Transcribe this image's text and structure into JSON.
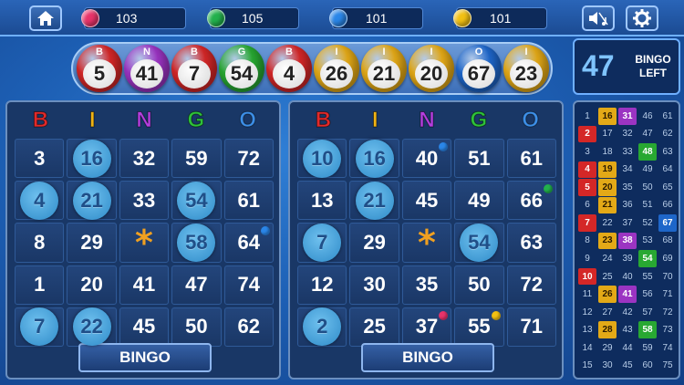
{
  "top_bar": {
    "home_icon": "home-icon",
    "gems": [
      {
        "name": "pink-gem-icon",
        "color": "#e8336a",
        "value": "103"
      },
      {
        "name": "green-gem-icon",
        "color": "#22b14c",
        "value": "105"
      },
      {
        "name": "blue-gem-icon",
        "color": "#2a86e8",
        "value": "101"
      },
      {
        "name": "yellow-gem-icon",
        "color": "#f2c012",
        "value": "101"
      }
    ],
    "sound_icon": "sound-music-icon",
    "settings_icon": "gear-icon"
  },
  "called_balls": [
    {
      "letter": "B",
      "number": "5",
      "color": "#d42727"
    },
    {
      "letter": "N",
      "number": "41",
      "color": "#9b34c2"
    },
    {
      "letter": "B",
      "number": "7",
      "color": "#d42727"
    },
    {
      "letter": "G",
      "number": "54",
      "color": "#28a832"
    },
    {
      "letter": "B",
      "number": "4",
      "color": "#d42727"
    },
    {
      "letter": "I",
      "number": "26",
      "color": "#e3a917"
    },
    {
      "letter": "I",
      "number": "21",
      "color": "#e3a917"
    },
    {
      "letter": "I",
      "number": "20",
      "color": "#e3a917"
    },
    {
      "letter": "O",
      "number": "67",
      "color": "#1e66c9"
    },
    {
      "letter": "I",
      "number": "23",
      "color": "#e3a917"
    }
  ],
  "bingo_left": {
    "count": "47",
    "label_line1": "BINGO",
    "label_line2": "LEFT"
  },
  "header_letters": [
    {
      "letter": "B",
      "color": "#e22a2a"
    },
    {
      "letter": "I",
      "color": "#f0b315"
    },
    {
      "letter": "N",
      "color": "#b43fe0"
    },
    {
      "letter": "G",
      "color": "#2ec23a"
    },
    {
      "letter": "O",
      "color": "#3d8fe8"
    }
  ],
  "cards": [
    {
      "bingo_label": "BINGO",
      "rows": [
        [
          {
            "v": "3"
          },
          {
            "v": "16",
            "m": true
          },
          {
            "v": "32"
          },
          {
            "v": "59"
          },
          {
            "v": "72"
          }
        ],
        [
          {
            "v": "4",
            "m": true
          },
          {
            "v": "21",
            "m": true
          },
          {
            "v": "33"
          },
          {
            "v": "54",
            "m": true
          },
          {
            "v": "61"
          }
        ],
        [
          {
            "v": "8"
          },
          {
            "v": "29"
          },
          {
            "v": "*",
            "free": true
          },
          {
            "v": "58",
            "m": true
          },
          {
            "v": "64",
            "gem": "#2a86e8"
          }
        ],
        [
          {
            "v": "1"
          },
          {
            "v": "20"
          },
          {
            "v": "41"
          },
          {
            "v": "47"
          },
          {
            "v": "74"
          }
        ],
        [
          {
            "v": "7",
            "m": true
          },
          {
            "v": "22",
            "m": true
          },
          {
            "v": "45"
          },
          {
            "v": "50"
          },
          {
            "v": "62"
          }
        ]
      ]
    },
    {
      "bingo_label": "BINGO",
      "rows": [
        [
          {
            "v": "10",
            "m": true
          },
          {
            "v": "16",
            "m": true
          },
          {
            "v": "40",
            "gem": "#2a86e8"
          },
          {
            "v": "51"
          },
          {
            "v": "61"
          }
        ],
        [
          {
            "v": "13"
          },
          {
            "v": "21",
            "m": true
          },
          {
            "v": "45"
          },
          {
            "v": "49"
          },
          {
            "v": "66",
            "gem": "#22b14c"
          }
        ],
        [
          {
            "v": "7",
            "m": true
          },
          {
            "v": "29"
          },
          {
            "v": "*",
            "free": true
          },
          {
            "v": "54",
            "m": true
          },
          {
            "v": "63"
          }
        ],
        [
          {
            "v": "12"
          },
          {
            "v": "30"
          },
          {
            "v": "35"
          },
          {
            "v": "50"
          },
          {
            "v": "72"
          }
        ],
        [
          {
            "v": "2",
            "m": true
          },
          {
            "v": "25"
          },
          {
            "v": "37",
            "gem": "#e8336a"
          },
          {
            "v": "55",
            "gem": "#f2c012"
          },
          {
            "v": "71"
          }
        ]
      ]
    }
  ],
  "board": {
    "rows": [
      [
        "1",
        "16",
        "31",
        "46",
        "61"
      ],
      [
        "2",
        "17",
        "32",
        "47",
        "62"
      ],
      [
        "3",
        "18",
        "33",
        "48",
        "63"
      ],
      [
        "4",
        "19",
        "34",
        "49",
        "64"
      ],
      [
        "5",
        "20",
        "35",
        "50",
        "65"
      ],
      [
        "6",
        "21",
        "36",
        "51",
        "66"
      ],
      [
        "7",
        "22",
        "37",
        "52",
        "67"
      ],
      [
        "8",
        "23",
        "38",
        "53",
        "68"
      ],
      [
        "9",
        "24",
        "39",
        "54",
        "69"
      ],
      [
        "10",
        "25",
        "40",
        "55",
        "70"
      ],
      [
        "11",
        "26",
        "41",
        "56",
        "71"
      ],
      [
        "12",
        "27",
        "42",
        "57",
        "72"
      ],
      [
        "13",
        "28",
        "43",
        "58",
        "73"
      ],
      [
        "14",
        "29",
        "44",
        "59",
        "74"
      ],
      [
        "15",
        "30",
        "45",
        "60",
        "75"
      ]
    ],
    "hits": {
      "16": "#e3a917",
      "31": "#9b34c2",
      "2": "#d42727",
      "48": "#28a832",
      "4": "#d42727",
      "19": "#e3a917",
      "5": "#d42727",
      "20": "#e3a917",
      "21": "#e3a917",
      "7": "#d42727",
      "67": "#1e66c9",
      "23": "#e3a917",
      "38": "#9b34c2",
      "54": "#28a832",
      "10": "#d42727",
      "26": "#e3a917",
      "41": "#9b34c2",
      "28": "#e3a917",
      "58": "#28a832"
    }
  }
}
